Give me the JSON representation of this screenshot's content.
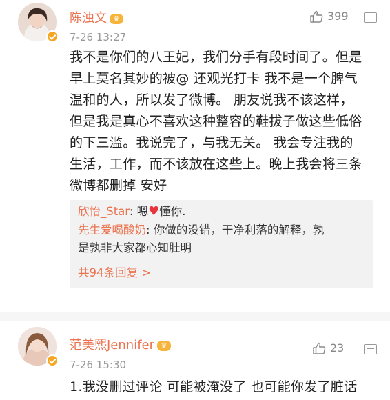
{
  "comment1": {
    "username": "陈浊文",
    "crown_badge": "vip-crown",
    "time": "7-26 13:27",
    "likes": "399",
    "text_lines": [
      "我不是你们的八王妃，我们分手有段时间了。但是",
      "早上莫名其妙的被@ 还观光打卡 我不是一个脾气",
      "温和的人，所以发了微博。 朋友说我不该这样，",
      "但是我是真心不喜欢这种整容的鞋拔子做这些低俗",
      "的下三滥。我说完了，与我无关。 我会专注我的",
      "生活，工作，而不该放在这些上。晚上我会将三条",
      "微博都删掉 安好"
    ],
    "replies": [
      {
        "user": "欣怡_Star",
        "sep": ": ",
        "pre": "嗯",
        "heart": "♥",
        "post": "懂你."
      },
      {
        "user": "先生爱喝酸奶",
        "sep": ": ",
        "line1": "你做的没错，干净利落的解释，孰",
        "line2": "是孰非大家都心知肚明"
      }
    ],
    "total_replies": "共94条回复 >"
  },
  "comment2": {
    "username": "范美熙Jennifer",
    "crown_badge": "vip-crown",
    "time": "7-26 15:30",
    "likes": "23",
    "text_lines": [
      "1.我没删过评论 可能被淹没了 也可能你发了脏话"
    ]
  },
  "colors": {
    "username": "#eb7350",
    "link": "#eb7350",
    "heart": "#e8343c",
    "reply_bg": "#f2f2f2"
  }
}
